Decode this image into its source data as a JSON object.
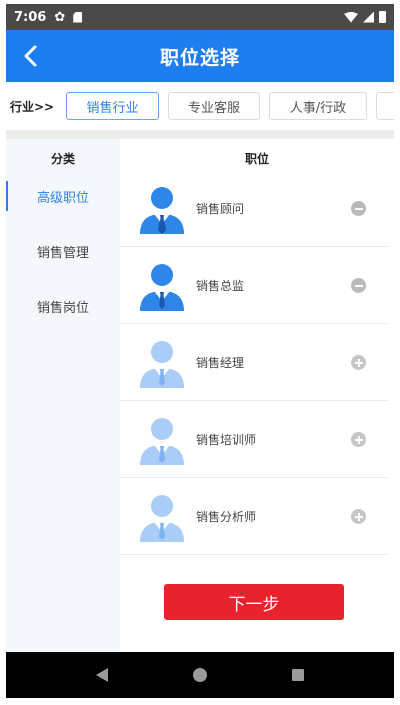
{
  "status_bar": {
    "time": "7:06"
  },
  "app_bar": {
    "title": "职位选择"
  },
  "industry": {
    "label": "行业>>",
    "chips": [
      "销售行业",
      "专业客服",
      "人事/行政",
      ""
    ],
    "active_index": 0
  },
  "sidebar": {
    "header": "分类",
    "items": [
      {
        "label": "高级职位",
        "active": true
      },
      {
        "label": "销售管理",
        "active": false
      },
      {
        "label": "销售岗位",
        "active": false
      }
    ]
  },
  "positions": {
    "header": "职位",
    "items": [
      {
        "label": "销售顾问",
        "selected": true,
        "toggle": "minus-icon"
      },
      {
        "label": "销售总监",
        "selected": true,
        "toggle": "minus-icon"
      },
      {
        "label": "销售经理",
        "selected": false,
        "toggle": "plus-icon"
      },
      {
        "label": "销售培训师",
        "selected": false,
        "toggle": "plus-icon"
      },
      {
        "label": "销售分析师",
        "selected": false,
        "toggle": "plus-icon"
      }
    ]
  },
  "next_button": {
    "label": "下一步"
  },
  "colors": {
    "primary": "#1e7ef0",
    "accent_red": "#e8232d",
    "avatar_selected": "#2f86e9",
    "avatar_unselected": "#a9cdf6"
  }
}
